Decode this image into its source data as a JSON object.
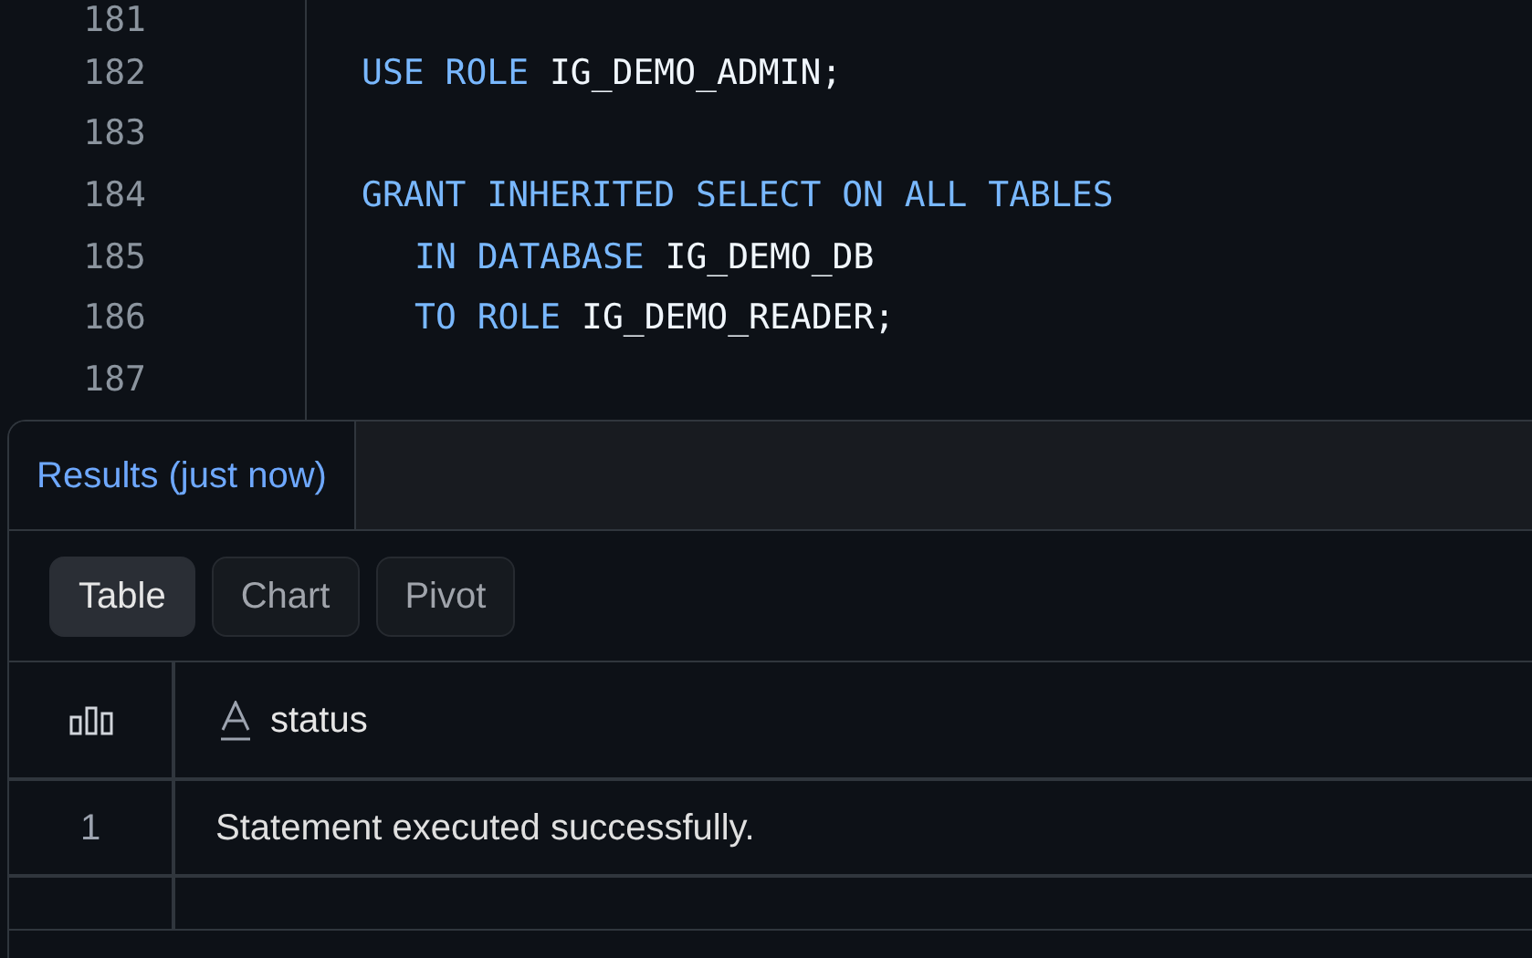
{
  "editor": {
    "lines": [
      {
        "number": "181"
      },
      {
        "number": "182",
        "tokens": [
          {
            "kind": "keyword",
            "text": "USE ROLE"
          },
          {
            "kind": "identifier",
            "text": "IG_DEMO_ADMIN;"
          }
        ],
        "indent": false
      },
      {
        "number": "183"
      },
      {
        "number": "184",
        "tokens": [
          {
            "kind": "keyword",
            "text": "GRANT INHERITED SELECT ON ALL TABLES"
          }
        ],
        "indent": false
      },
      {
        "number": "185",
        "tokens": [
          {
            "kind": "keyword",
            "text": "IN DATABASE"
          },
          {
            "kind": "identifier",
            "text": "IG_DEMO_DB"
          }
        ],
        "indent": true
      },
      {
        "number": "186",
        "tokens": [
          {
            "kind": "keyword",
            "text": "TO ROLE"
          },
          {
            "kind": "identifier",
            "text": "IG_DEMO_READER;"
          }
        ],
        "indent": true
      },
      {
        "number": "187"
      }
    ]
  },
  "results": {
    "tabs": [
      {
        "label": "Results (just now)",
        "selected": true
      }
    ],
    "views": [
      {
        "label": "Table",
        "selected": true
      },
      {
        "label": "Chart",
        "selected": false
      },
      {
        "label": "Pivot",
        "selected": false
      }
    ],
    "table": {
      "columns": [
        {
          "label": "status"
        }
      ],
      "rows": [
        {
          "index": "1",
          "cells": [
            "Statement executed successfully."
          ]
        }
      ]
    }
  }
}
